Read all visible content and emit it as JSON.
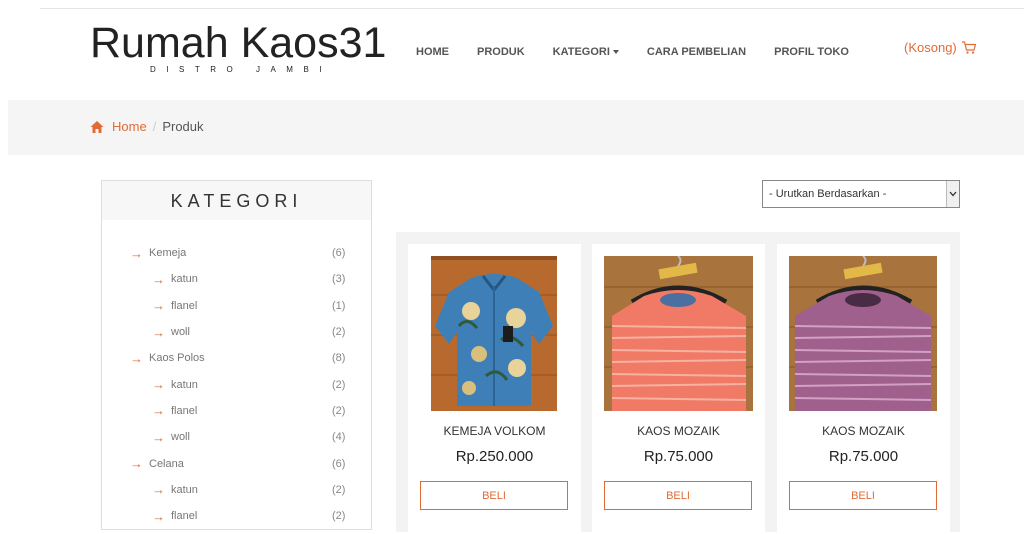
{
  "header": {
    "logo_title": "Rumah Kaos31",
    "logo_subtitle": "DISTRO JAMBI",
    "nav": [
      {
        "label": "HOME"
      },
      {
        "label": "PRODUK"
      },
      {
        "label": "KATEGORI"
      },
      {
        "label": "CARA PEMBELIAN"
      },
      {
        "label": "PROFIL TOKO"
      }
    ],
    "cart_label": "(Kosong)"
  },
  "breadcrumb": {
    "home": "Home",
    "separator": "/",
    "current": "Produk"
  },
  "sidebar": {
    "title": "KATEGORI",
    "items": [
      {
        "label": "Kemeja",
        "count": "(6)"
      },
      {
        "label": "katun",
        "count": "(3)"
      },
      {
        "label": "flanel",
        "count": "(1)"
      },
      {
        "label": "woll",
        "count": "(2)"
      },
      {
        "label": "Kaos Polos",
        "count": "(8)"
      },
      {
        "label": "katun",
        "count": "(2)"
      },
      {
        "label": "flanel",
        "count": "(2)"
      },
      {
        "label": "woll",
        "count": "(4)"
      },
      {
        "label": "Celana",
        "count": "(6)"
      },
      {
        "label": "katun",
        "count": "(2)"
      },
      {
        "label": "flanel",
        "count": "(2)"
      }
    ]
  },
  "sort": {
    "selected": "- Urutkan Berdasarkan -"
  },
  "products": [
    {
      "name": "KEMEJA VOLKOM",
      "price": "Rp.250.000",
      "buy_label": "BELI"
    },
    {
      "name": "KAOS MOZAIK",
      "price": "Rp.75.000",
      "buy_label": "BELI"
    },
    {
      "name": "KAOS MOZAIK",
      "price": "Rp.75.000",
      "buy_label": "BELI"
    }
  ],
  "colors": {
    "accent": "#e16b36",
    "breadcrumb_bg": "#f5f5f5",
    "panel_bg": "#f3f3f3"
  },
  "icons": {
    "cart": "cart-icon",
    "home": "home-icon",
    "arrow": "arrow-right-icon",
    "select": "chevron-down-icon"
  }
}
